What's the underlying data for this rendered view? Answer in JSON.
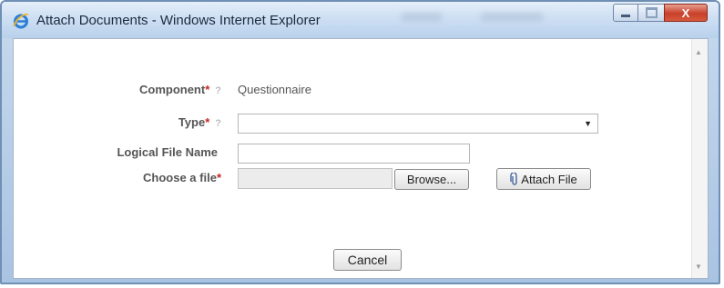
{
  "window": {
    "title": "Attach Documents - Windows Internet Explorer",
    "close_glyph": "X",
    "icons": [
      "ie-logo-icon",
      "minimize-icon",
      "maximize-icon",
      "close-icon"
    ]
  },
  "form": {
    "component": {
      "label": "Component",
      "required": "*",
      "help": "?",
      "value": "Questionnaire"
    },
    "type": {
      "label": "Type",
      "required": "*",
      "help": "?",
      "selected": ""
    },
    "logical_file_name": {
      "label": "Logical File Name",
      "value": ""
    },
    "choose_file": {
      "label": "Choose a file",
      "required": "*",
      "value": "",
      "browse_label": "Browse..."
    }
  },
  "buttons": {
    "attach_label": "Attach File",
    "cancel_label": "Cancel"
  },
  "colors": {
    "required": "#cc2222",
    "label": "#555555",
    "titlebar": "#cddff3",
    "close_button": "#c8402a"
  }
}
